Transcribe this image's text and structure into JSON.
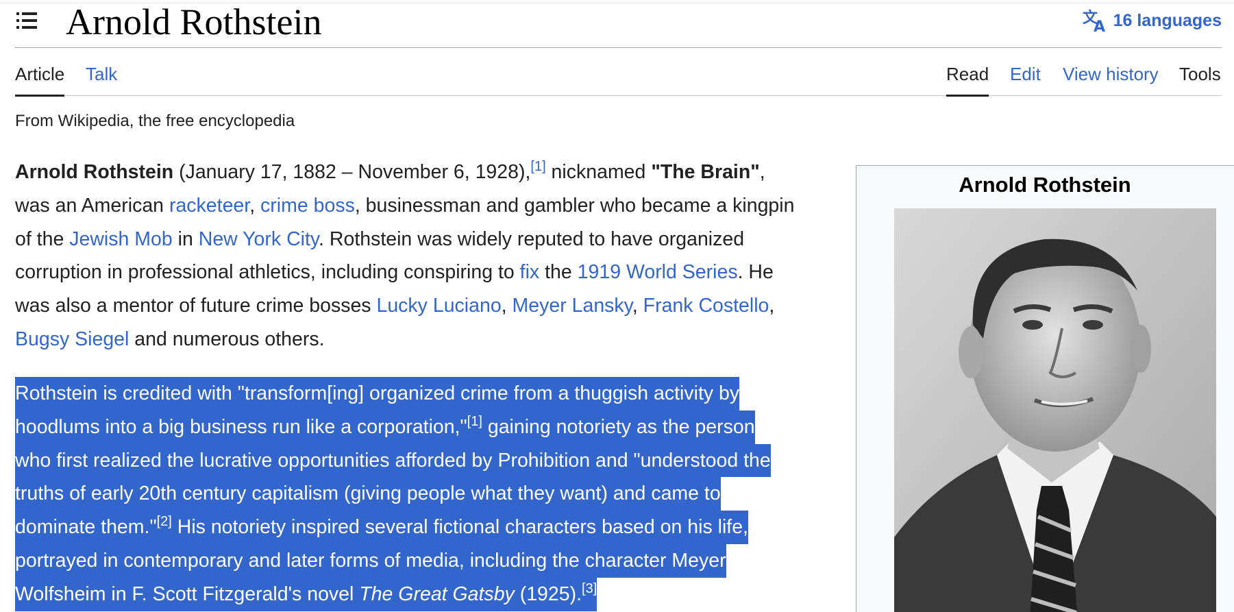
{
  "header": {
    "title": "Arnold Rothstein",
    "languages_label": "16 languages"
  },
  "tabs": {
    "article": "Article",
    "talk": "Talk",
    "read": "Read",
    "edit": "Edit",
    "view_history": "View history",
    "tools": "Tools"
  },
  "tagline": "From Wikipedia, the free encyclopedia",
  "para1": {
    "l1_bold": "Arnold Rothstein",
    "l1_text": " (January 17, 1882 – November 6, 1928),",
    "l1_ref": "[1]",
    "l1_text2": " nicknamed ",
    "l1_bold2": "\"The Brain\"",
    "l1_text3": ",",
    "l2_text": "was an American ",
    "l2_link1": "racketeer",
    "l2_comma": ", ",
    "l2_link2": "crime boss",
    "l2_text2": ", businessman and gambler who became a kingpin",
    "l3_text": "of the ",
    "l3_link1": "Jewish Mob",
    "l3_in": " in ",
    "l3_link2": "New York City",
    "l3_text2": ". Rothstein was widely reputed to have organized",
    "l4_text": "corruption in professional athletics, including conspiring to ",
    "l4_link1": "fix",
    "l4_the": " the ",
    "l4_link2": "1919 World Series",
    "l4_text2": ". He",
    "l5_text": "was also a mentor of future crime bosses ",
    "l5_link1": "Lucky Luciano",
    "l5_c1": ", ",
    "l5_link2": "Meyer Lansky",
    "l5_c2": ", ",
    "l5_link3": "Frank Costello",
    "l5_c3": ",",
    "l6_link1": "Bugsy Siegel",
    "l6_text": " and numerous others."
  },
  "para2": {
    "l1": "Rothstein is credited with \"transform[ing] organized crime from a thuggish activity by",
    "l2_a": "hoodlums into a big business run like a corporation,\"",
    "l2_ref": "[1]",
    "l2_b": " gaining notoriety as the person",
    "l3": "who first realized the lucrative opportunities afforded by Prohibition and \"understood the",
    "l4": "truths of early 20th century capitalism (giving people what they want) and came to",
    "l5_a": "dominate them.\"",
    "l5_ref": "[2]",
    "l5_b": " His notoriety inspired several fictional characters based on his life,",
    "l6": "portrayed in contemporary and later forms of media, including the character Meyer",
    "l7_a": "Wolfsheim in F. Scott Fitzgerald's novel ",
    "l7_i": "The Great Gatsby",
    "l7_b": " (1925).",
    "l7_ref": "[3]"
  },
  "infobox": {
    "title": "Arnold Rothstein",
    "image_icon": "portrait-photo"
  },
  "colors": {
    "link": "#3366cc",
    "selection": "#3366cc",
    "text": "#202122"
  }
}
